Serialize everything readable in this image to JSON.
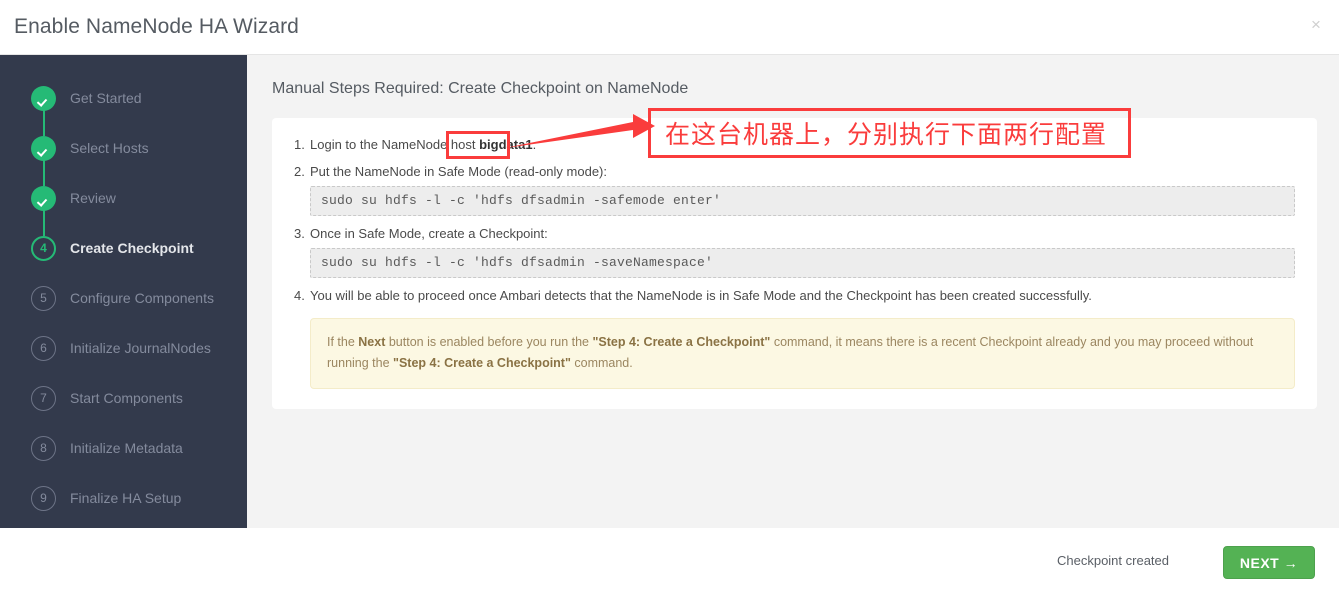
{
  "window": {
    "title": "Enable NameNode HA Wizard",
    "close_icon": "close-icon",
    "close_glyph": "×"
  },
  "sidebar": {
    "items": [
      {
        "number": "1",
        "label": "Get Started",
        "state": "done"
      },
      {
        "number": "2",
        "label": "Select Hosts",
        "state": "done"
      },
      {
        "number": "3",
        "label": "Review",
        "state": "done"
      },
      {
        "number": "4",
        "label": "Create Checkpoint",
        "state": "active"
      },
      {
        "number": "5",
        "label": "Configure Components",
        "state": "todo"
      },
      {
        "number": "6",
        "label": "Initialize JournalNodes",
        "state": "todo"
      },
      {
        "number": "7",
        "label": "Start Components",
        "state": "todo"
      },
      {
        "number": "8",
        "label": "Initialize Metadata",
        "state": "todo"
      },
      {
        "number": "9",
        "label": "Finalize HA Setup",
        "state": "todo"
      }
    ]
  },
  "content": {
    "heading": "Manual Steps Required: Create Checkpoint on NameNode",
    "steps": [
      {
        "text_before": "Login to the NameNode host ",
        "host": "bigdata1",
        "text_after": ".",
        "command": ""
      },
      {
        "text_before": "Put the NameNode in Safe Mode (read-only mode):",
        "host": "",
        "text_after": "",
        "command": "sudo su hdfs -l -c 'hdfs dfsadmin -safemode enter'"
      },
      {
        "text_before": "Once in Safe Mode, create a Checkpoint:",
        "host": "",
        "text_after": "",
        "command": "sudo su hdfs -l -c 'hdfs dfsadmin -saveNamespace'"
      },
      {
        "text_before": "You will be able to proceed once Ambari detects that the NameNode is in Safe Mode and the Checkpoint has been created successfully.",
        "host": "",
        "text_after": "",
        "command": ""
      }
    ],
    "alert": {
      "part1": "If the ",
      "bold1": "Next",
      "part2": " button is enabled before you run the ",
      "bold2": "\"Step 4: Create a Checkpoint\"",
      "part3": " command, it means there is a recent Checkpoint already and you may proceed without running the ",
      "bold3": "\"Step 4: Create a Checkpoint\"",
      "part4": " command."
    }
  },
  "footer": {
    "status": "Checkpoint created",
    "next_label": "NEXT →"
  },
  "annotation": {
    "text": "在这台机器上，分别执行下面两行配置",
    "color": "#fa3c3c"
  }
}
